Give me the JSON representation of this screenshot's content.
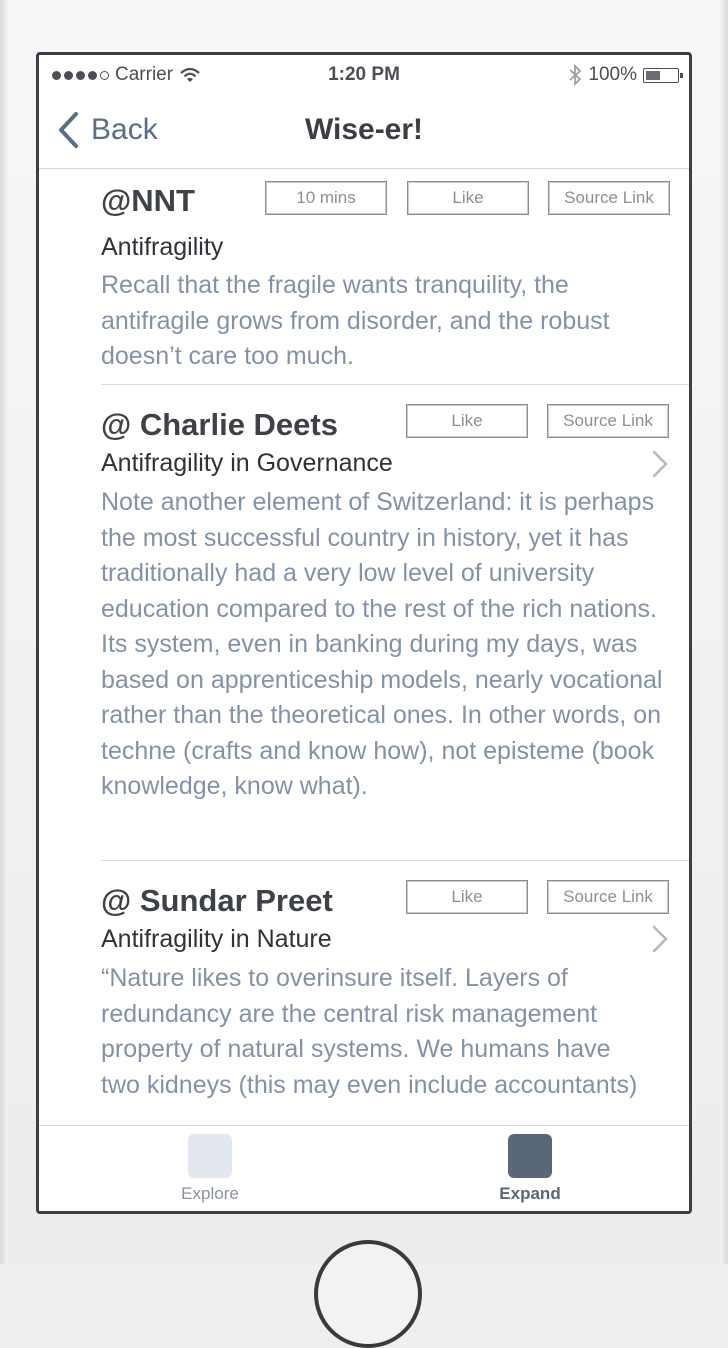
{
  "status_bar": {
    "carrier": "Carrier",
    "time": "1:20 PM",
    "battery": "100%",
    "battery_level": 0.45
  },
  "nav": {
    "back_label": "Back",
    "title": "Wise-er!"
  },
  "posts": [
    {
      "author": "@NNT",
      "time_badge": "10 mins",
      "like_label": "Like",
      "source_label": "Source Link",
      "title": "Antifragility",
      "body": "Recall that the fragile wants tranquility, the antifragile grows from disorder, and the robust doesn’t care too much."
    },
    {
      "author": "@ Charlie Deets",
      "like_label": "Like",
      "source_label": "Source Link",
      "title": "Antifragility in Governance",
      "body": "Note another element of Switzerland: it is perhaps the most successful country in history, yet it has traditionally had a very low level of university education compared to the rest of the rich nations. Its system, even in banking during my days, was based on apprenticeship models, nearly vocational rather than the theoretical ones. In other words, on techne (crafts and know how), not episteme (book knowledge, know what)."
    },
    {
      "author": "@ Sundar Preet",
      "like_label": "Like",
      "source_label": "Source Link",
      "title": "Antifragility in Nature",
      "body": " “Nature likes to overinsure itself. Layers of redundancy are the central risk management property of natural systems. We humans have two kidneys (this may even include accountants)"
    }
  ],
  "tabs": [
    {
      "label": "Explore",
      "color": "#e3e7ef",
      "label_color": "#8a929c"
    },
    {
      "label": "Expand",
      "color": "#5a6778",
      "label_color": "#5a6778"
    }
  ]
}
